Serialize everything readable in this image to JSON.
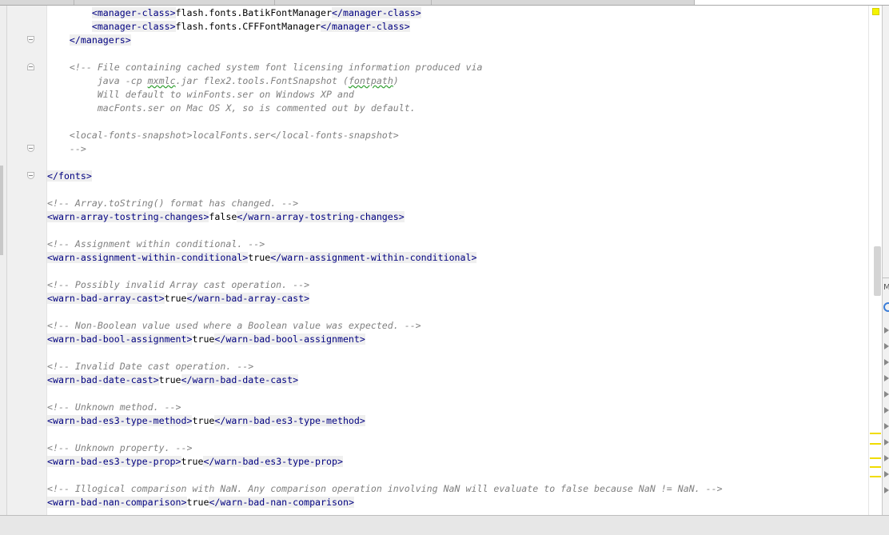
{
  "editor": {
    "lines": [
      [
        {
          "t": "        "
        },
        {
          "t": "<manager-class>",
          "c": "tag"
        },
        {
          "t": "flash.fonts.BatikFontManager",
          "c": "txt"
        },
        {
          "t": "</manager-class>",
          "c": "tag"
        }
      ],
      [
        {
          "t": "        "
        },
        {
          "t": "<manager-class>",
          "c": "tag"
        },
        {
          "t": "flash.fonts.CFFFontManager",
          "c": "txt"
        },
        {
          "t": "</manager-class>",
          "c": "tag"
        }
      ],
      [
        {
          "t": "    "
        },
        {
          "t": "</managers>",
          "c": "tag"
        }
      ],
      [
        {
          "t": ""
        }
      ],
      [
        {
          "t": "    "
        },
        {
          "t": "<!-- File containing cached system font licensing information produced via",
          "c": "cmt"
        }
      ],
      [
        {
          "t": "         "
        },
        {
          "t": "java -cp ",
          "c": "cmt"
        },
        {
          "t": "mxmlc",
          "c": "cmt err"
        },
        {
          "t": ".jar flex2.tools.FontSnapshot (",
          "c": "cmt"
        },
        {
          "t": "fontpath",
          "c": "cmt err"
        },
        {
          "t": ")",
          "c": "cmt"
        }
      ],
      [
        {
          "t": "         "
        },
        {
          "t": "Will default to winFonts.ser on Windows XP and",
          "c": "cmt"
        }
      ],
      [
        {
          "t": "         "
        },
        {
          "t": "macFonts.ser on Mac OS X, so is commented out by default.",
          "c": "cmt"
        }
      ],
      [
        {
          "t": ""
        }
      ],
      [
        {
          "t": "    "
        },
        {
          "t": "<local-fonts-snapshot>localFonts.ser</local-fonts-snapshot>",
          "c": "cmt"
        }
      ],
      [
        {
          "t": "    "
        },
        {
          "t": "-->",
          "c": "cmt"
        }
      ],
      [
        {
          "t": ""
        }
      ],
      [
        {
          "t": "</fonts>",
          "c": "tag"
        }
      ],
      [
        {
          "t": ""
        }
      ],
      [
        {
          "t": "<!-- Array.toString() format has changed. -->",
          "c": "cmt"
        }
      ],
      [
        {
          "t": "<warn-array-tostring-changes>",
          "c": "tag"
        },
        {
          "t": "false",
          "c": "txt"
        },
        {
          "t": "</warn-array-tostring-changes>",
          "c": "tag"
        }
      ],
      [
        {
          "t": ""
        }
      ],
      [
        {
          "t": "<!-- Assignment within conditional. -->",
          "c": "cmt"
        }
      ],
      [
        {
          "t": "<warn-assignment-within-conditional>",
          "c": "tag"
        },
        {
          "t": "true",
          "c": "txt"
        },
        {
          "t": "</warn-assignment-within-conditional>",
          "c": "tag"
        }
      ],
      [
        {
          "t": ""
        }
      ],
      [
        {
          "t": "<!-- Possibly invalid Array cast operation. -->",
          "c": "cmt"
        }
      ],
      [
        {
          "t": "<warn-bad-array-cast>",
          "c": "tag"
        },
        {
          "t": "true",
          "c": "txt"
        },
        {
          "t": "</warn-bad-array-cast>",
          "c": "tag"
        }
      ],
      [
        {
          "t": ""
        }
      ],
      [
        {
          "t": "<!-- Non-Boolean value used where a Boolean value was expected. -->",
          "c": "cmt"
        }
      ],
      [
        {
          "t": "<warn-bad-bool-assignment>",
          "c": "tag"
        },
        {
          "t": "true",
          "c": "txt"
        },
        {
          "t": "</warn-bad-bool-assignment>",
          "c": "tag"
        }
      ],
      [
        {
          "t": ""
        }
      ],
      [
        {
          "t": "<!-- Invalid Date cast operation. -->",
          "c": "cmt"
        }
      ],
      [
        {
          "t": "<warn-bad-date-cast>",
          "c": "tag"
        },
        {
          "t": "true",
          "c": "txt"
        },
        {
          "t": "</warn-bad-date-cast>",
          "c": "tag"
        }
      ],
      [
        {
          "t": ""
        }
      ],
      [
        {
          "t": "<!-- Unknown method. -->",
          "c": "cmt"
        }
      ],
      [
        {
          "t": "<warn-bad-es3-type-method>",
          "c": "tag"
        },
        {
          "t": "true",
          "c": "txt"
        },
        {
          "t": "</warn-bad-es3-type-method>",
          "c": "tag"
        }
      ],
      [
        {
          "t": ""
        }
      ],
      [
        {
          "t": "<!-- Unknown property. -->",
          "c": "cmt"
        }
      ],
      [
        {
          "t": "<warn-bad-es3-type-prop>",
          "c": "tag"
        },
        {
          "t": "true",
          "c": "txt"
        },
        {
          "t": "</warn-bad-es3-type-prop>",
          "c": "tag"
        }
      ],
      [
        {
          "t": ""
        }
      ],
      [
        {
          "t": "<!-- Illogical comparison with NaN. Any comparison operation involving NaN will evaluate to false because NaN != NaN. -->",
          "c": "cmt"
        }
      ],
      [
        {
          "t": "<warn-bad-nan-comparison>",
          "c": "tag"
        },
        {
          "t": "true",
          "c": "txt"
        },
        {
          "t": "</warn-bad-nan-comparison>",
          "c": "tag"
        }
      ]
    ]
  },
  "right_panel": {
    "label": "M"
  },
  "colors": {
    "tag": "#000080",
    "comment": "#808080",
    "text": "#000000",
    "tag_background": "#efefef",
    "warning_marker": "#f0dc00"
  }
}
